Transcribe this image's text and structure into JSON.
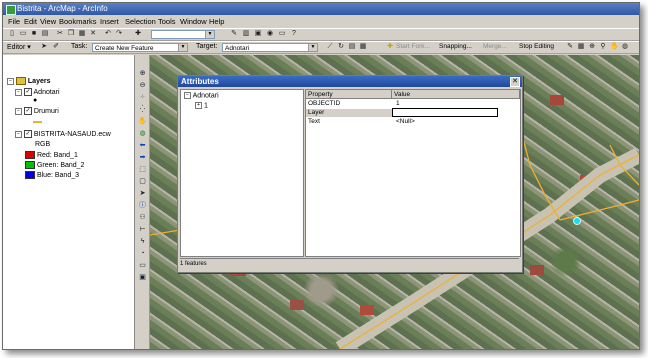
{
  "window": {
    "title": "Bistrita - ArcMap - ArcInfo"
  },
  "menu": [
    "File",
    "Edit",
    "View",
    "Bookmarks",
    "Insert",
    "Selection",
    "Tools",
    "Window",
    "Help"
  ],
  "editor": {
    "editor_label": "Editor ▾",
    "task_label": "Task:",
    "task_value": "Create New Feature",
    "target_label": "Target:",
    "target_value": "Adnotari",
    "start_fork": "Start Fork...",
    "snapping": "Snapping...",
    "merge": "Merge...",
    "stop_editing": "Stop Editing"
  },
  "toc": {
    "root": "Layers",
    "layers": [
      {
        "name": "Adnotari"
      },
      {
        "name": "Drumuri"
      },
      {
        "name": "BISTRITA-NASAUD.ecw"
      }
    ],
    "rgb_label": "RGB",
    "bands": [
      {
        "label": "Red:",
        "band": "Band_1",
        "color": "#e00000"
      },
      {
        "label": "Green:",
        "band": "Band_2",
        "color": "#00c000"
      },
      {
        "label": "Blue:",
        "band": "Band_3",
        "color": "#0000e0"
      }
    ]
  },
  "attributes": {
    "title": "Attributes",
    "tree_root": "Adnotari",
    "tree_child": "1",
    "columns": [
      "Property",
      "Value"
    ],
    "rows": [
      {
        "property": "OBJECTID",
        "value": "1"
      },
      {
        "property": "Layer",
        "value": ""
      },
      {
        "property": "Text",
        "value": "<Null>"
      }
    ],
    "status": "1 features"
  },
  "colors": {
    "road": "#f0b030",
    "selected_point": "#18e0f0",
    "title_blue": "#2e58a8"
  }
}
